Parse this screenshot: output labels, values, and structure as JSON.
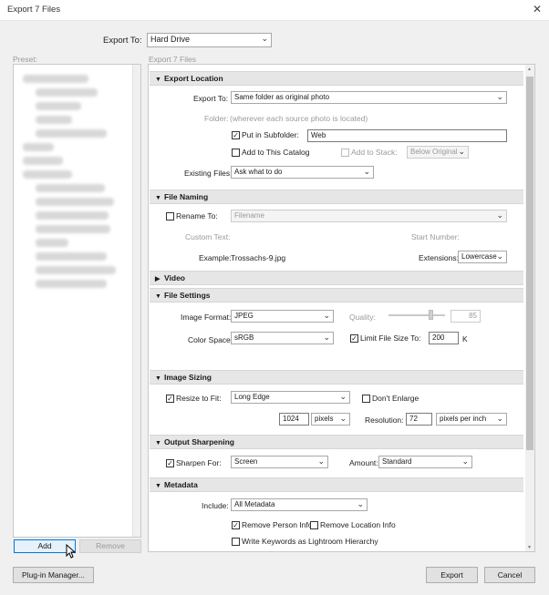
{
  "window": {
    "title": "Export 7 Files",
    "close_glyph": "✕"
  },
  "export_to": {
    "label": "Export To:",
    "value": "Hard Drive"
  },
  "preset": {
    "label": "Preset:",
    "add_label": "Add",
    "remove_label": "Remove"
  },
  "panel_header": "Export 7 Files",
  "sections": {
    "export_location": {
      "title": "Export Location",
      "export_to_label": "Export To:",
      "export_to_value": "Same folder as original photo",
      "folder_label": "Folder:",
      "folder_value": "(wherever each source photo is located)",
      "put_in_subfolder_label": "Put in Subfolder:",
      "subfolder_value": "Web",
      "add_to_catalog_label": "Add to This Catalog",
      "add_to_stack_label": "Add to Stack:",
      "stack_value": "Below Original",
      "existing_files_label": "Existing Files:",
      "existing_files_value": "Ask what to do"
    },
    "file_naming": {
      "title": "File Naming",
      "rename_to_label": "Rename To:",
      "rename_value": "Filename",
      "custom_text_label": "Custom Text:",
      "start_number_label": "Start Number:",
      "example_label": "Example:",
      "example_value": "Trossachs-9.jpg",
      "extensions_label": "Extensions:",
      "extensions_value": "Lowercase"
    },
    "video": {
      "title": "Video"
    },
    "file_settings": {
      "title": "File Settings",
      "image_format_label": "Image Format:",
      "image_format_value": "JPEG",
      "quality_label": "Quality:",
      "quality_value": "85",
      "color_space_label": "Color Space:",
      "color_space_value": "sRGB",
      "limit_label": "Limit File Size To:",
      "limit_value": "200",
      "limit_unit": "K"
    },
    "image_sizing": {
      "title": "Image Sizing",
      "resize_label": "Resize to Fit:",
      "resize_value": "Long Edge",
      "dont_enlarge_label": "Don't Enlarge",
      "size_value": "1024",
      "size_unit": "pixels",
      "resolution_label": "Resolution:",
      "resolution_value": "72",
      "resolution_unit": "pixels per inch"
    },
    "output_sharpening": {
      "title": "Output Sharpening",
      "sharpen_label": "Sharpen For:",
      "sharpen_value": "Screen",
      "amount_label": "Amount:",
      "amount_value": "Standard"
    },
    "metadata": {
      "title": "Metadata",
      "include_label": "Include:",
      "include_value": "All Metadata",
      "remove_person_label": "Remove Person Info",
      "remove_location_label": "Remove Location Info",
      "write_keywords_label": "Write Keywords as Lightroom Hierarchy"
    }
  },
  "footer": {
    "plugin_label": "Plug-in Manager...",
    "export_label": "Export",
    "cancel_label": "Cancel"
  },
  "icons": {
    "caret": "⌄",
    "expanded": "▼",
    "collapsed": "▶",
    "check": "✓"
  }
}
